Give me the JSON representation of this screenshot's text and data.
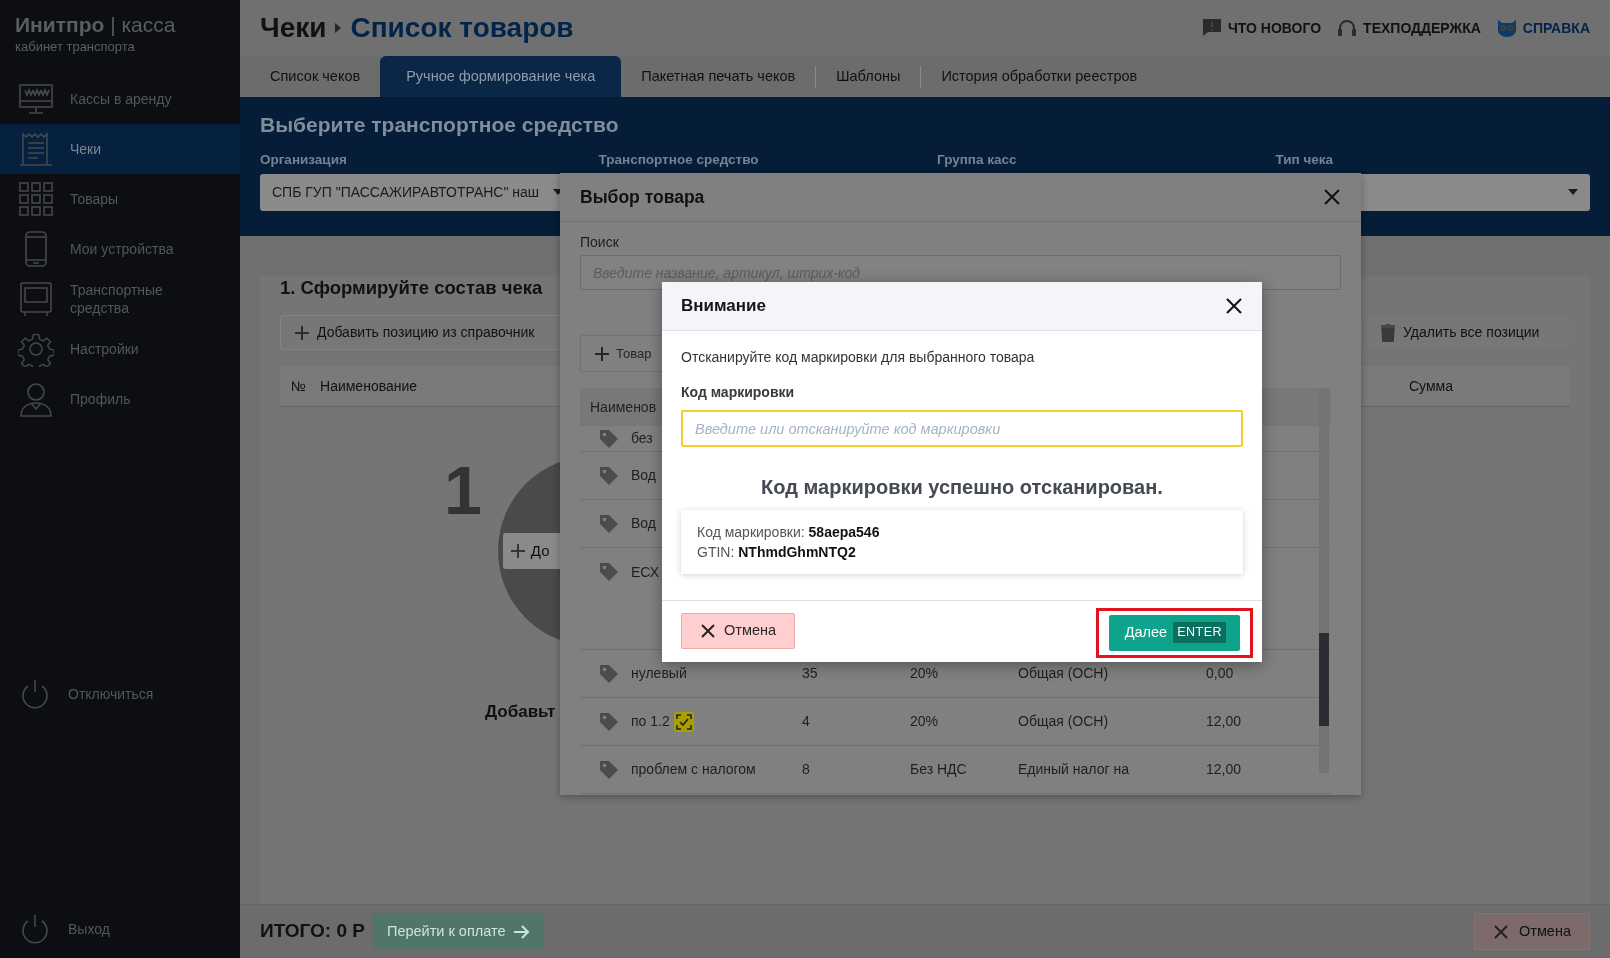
{
  "sidebar": {
    "logo": "**Инитпро** | касса",
    "subtitle": "кабинет транспорта",
    "items": [
      {
        "label": "Кассы в аренду",
        "selected": false
      },
      {
        "label": "Чеки",
        "selected": true
      },
      {
        "label": "Товары",
        "selected": false
      },
      {
        "label": "Мои устройства",
        "selected": false
      },
      {
        "label": "Транспортные средства",
        "selected": false
      },
      {
        "label": "Настройки",
        "selected": false
      },
      {
        "label": "Профиль",
        "selected": false
      }
    ],
    "disconnect": "Отключиться",
    "logout": "Выход"
  },
  "header": {
    "breadcrumb": [
      "Чеки",
      "Список товаров"
    ],
    "links": [
      {
        "label": "ЧТО НОВОГО",
        "color": "#111111"
      },
      {
        "label": "ТЕХПОДДЕРЖКА",
        "color": "#111111"
      },
      {
        "label": "СПРАВКА",
        "color": "#02234a"
      }
    ]
  },
  "tabs": [
    {
      "label": "Список чеков",
      "selected": false
    },
    {
      "label": "Ручное формирование чека",
      "selected": true
    },
    {
      "label": "Пакетная печать чеков",
      "selected": false
    },
    {
      "label": "Шаблоны",
      "selected": false
    },
    {
      "label": "История обработки реестров",
      "selected": false
    }
  ],
  "vehicle_filter": {
    "title": "Выберите транспортное средство",
    "fields": [
      {
        "label": "Организация",
        "value": "СПБ ГУП \"ПАССАЖИРАВТОТРАНС\" наш"
      },
      {
        "label": "Транспортное средство"
      },
      {
        "label": "Группа касс"
      },
      {
        "label": "Тип чека"
      }
    ]
  },
  "composition": {
    "title": "1. Сформируйте состав чека",
    "add_button": "Добавить позицию из справочник",
    "delete_all_button": "Удалить все позиции",
    "columns": [
      "№",
      "Наименование",
      "Сумма"
    ],
    "empty_state": {
      "step": "1",
      "add_button": "До",
      "hint": "Добавьт"
    }
  },
  "footer": {
    "total": "ИТОГО: 0 Р",
    "pay_button": "Перейти к оплате",
    "cancel_button": "Отмена"
  },
  "product_dialog": {
    "title": "Выбор товара",
    "search": {
      "label": "Поиск",
      "placeholder": "Введите название, артикул, штрих-код"
    },
    "add_button": "Товар",
    "columns": [
      "Наименов"
    ],
    "rows": [
      {
        "name": "без",
        "marked": false
      },
      {
        "name": "Вод",
        "marked": false
      },
      {
        "name": "Вод",
        "marked": false
      },
      {
        "name": "ЕСХ",
        "marked": false
      },
      {
        "name": "нулевый",
        "marked": false,
        "cells": [
          "35",
          "20%",
          "Общая (ОСН)",
          "0,00"
        ]
      },
      {
        "name": "по 1.2",
        "marked": true,
        "cells": [
          "4",
          "20%",
          "Общая (ОСН)",
          "12,00"
        ]
      },
      {
        "name": "проблем с налогом",
        "marked": false,
        "cells": [
          "8",
          "Без НДС",
          "Единый налог на",
          "12,00"
        ]
      }
    ]
  },
  "attention_dialog": {
    "title": "Внимание",
    "message": "Отсканируйте код маркировки для выбранного товара",
    "code_field": {
      "label": "Код маркировки",
      "placeholder": "Введите или отсканируйте код маркировки",
      "focused": true
    },
    "success": "Код маркировки успешно отсканирован.",
    "result": [
      "Код маркировки: **58aepa546**",
      "GTIN: **NThmdGhmNTQ2**"
    ],
    "cancel_button": "Отмена",
    "next_button": {
      "label": "Далее",
      "key": "ENTER",
      "highlighted": true
    }
  }
}
